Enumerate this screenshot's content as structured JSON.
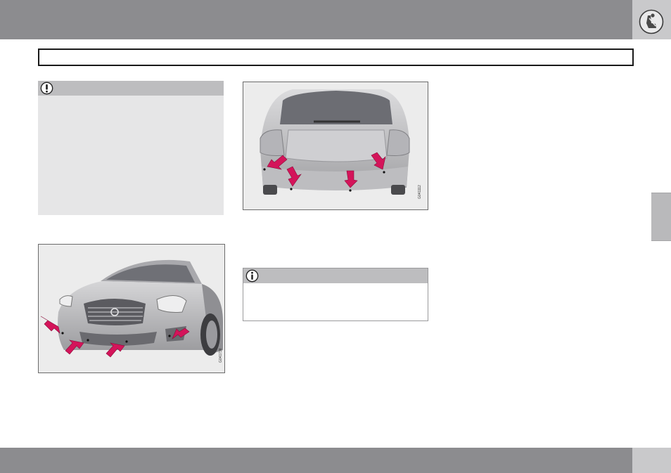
{
  "colors": {
    "header_bar": "#8c8c8f",
    "corner_tab": "#c9c9cb",
    "callout_bg": "#e6e6e7",
    "callout_head": "#bdbdbf",
    "arrow": "#d4145a"
  },
  "icons": {
    "header": "seat-belt-icon",
    "warning": "exclamation-icon",
    "info": "information-icon"
  },
  "figures": {
    "front_code": "G041738",
    "rear_code": "G041112"
  }
}
